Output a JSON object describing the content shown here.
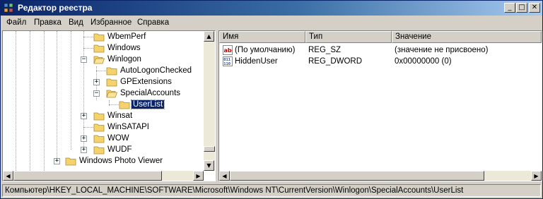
{
  "window": {
    "title": "Редактор реестра",
    "min_glyph": "_",
    "max_glyph": "□",
    "close_glyph": "✕"
  },
  "menu": [
    "Файл",
    "Правка",
    "Вид",
    "Избранное",
    "Справка"
  ],
  "tree": [
    {
      "label": "WbemPerf",
      "expander": ""
    },
    {
      "label": "Windows",
      "expander": ""
    },
    {
      "label": "Winlogon",
      "expander": "−"
    },
    {
      "label": "AutoLogonChecked",
      "expander": ""
    },
    {
      "label": "GPExtensions",
      "expander": "+"
    },
    {
      "label": "SpecialAccounts",
      "expander": "−"
    },
    {
      "label": "UserList",
      "expander": "",
      "selected": true
    },
    {
      "label": "Winsat",
      "expander": "+"
    },
    {
      "label": "WinSATAPI",
      "expander": ""
    },
    {
      "label": "WOW",
      "expander": "+"
    },
    {
      "label": "WUDF",
      "expander": "+"
    },
    {
      "label": "Windows Photo Viewer",
      "expander": "+"
    }
  ],
  "list": {
    "columns": [
      "Имя",
      "Тип",
      "Значение"
    ],
    "rows": [
      {
        "icon": "string-value-icon",
        "name": "(По умолчанию)",
        "type": "REG_SZ",
        "value": "(значение не присвоено)"
      },
      {
        "icon": "binary-value-icon",
        "name": "HiddenUser",
        "type": "REG_DWORD",
        "value": "0x00000000 (0)"
      }
    ]
  },
  "status": {
    "path": "Компьютер\\HKEY_LOCAL_MACHINE\\SOFTWARE\\Microsoft\\Windows NT\\CurrentVersion\\Winlogon\\SpecialAccounts\\UserList"
  },
  "icons": {
    "scroll_up": "▲",
    "scroll_down": "▼",
    "scroll_left": "◀",
    "scroll_right": "▶"
  },
  "colors": {
    "title_start": "#0a246a",
    "title_end": "#a6caf0",
    "selection": "#0a246a",
    "folder": "#f5d26b"
  }
}
